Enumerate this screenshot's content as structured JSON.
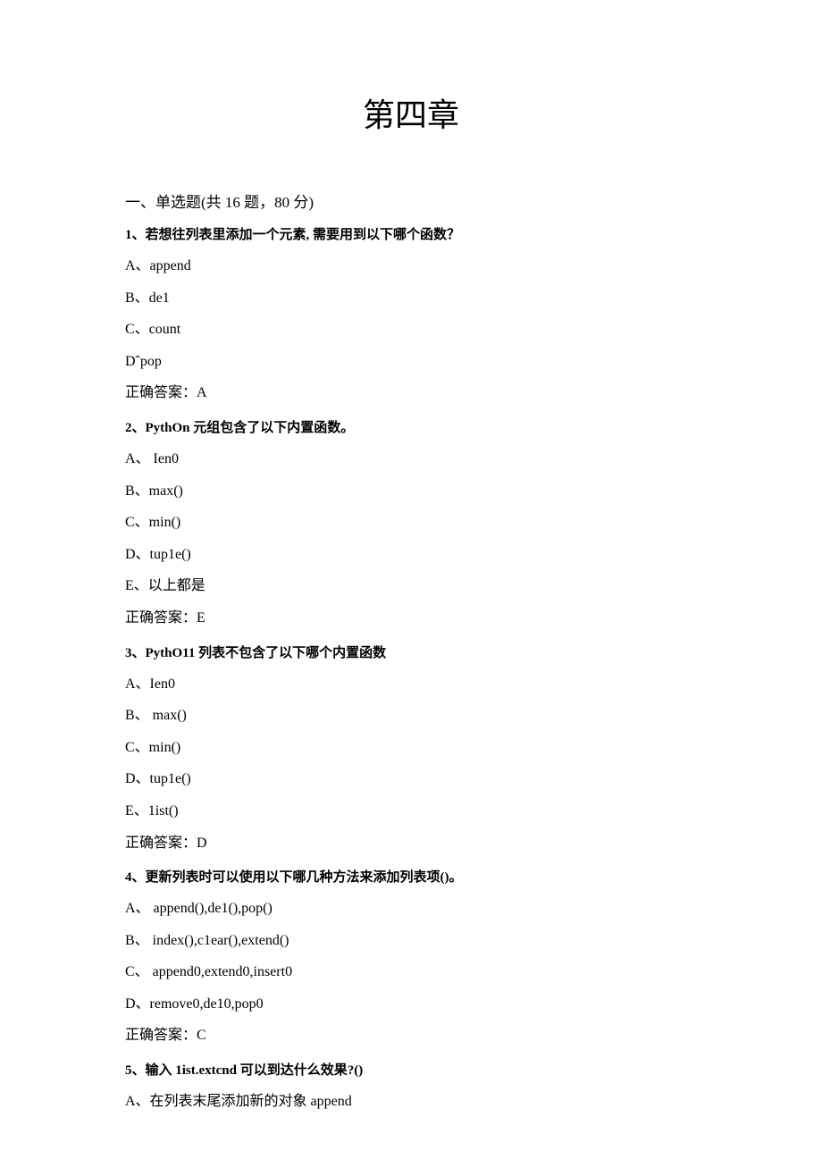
{
  "title": "第四章",
  "section_header": "一、单选题(共 16 题，80 分)",
  "questions": [
    {
      "stem": "1、若想往列表里添加一个元素, 需要用到以下哪个函数？",
      "options": [
        "A、append",
        "B、de1",
        "C、count",
        "Dˆpop"
      ],
      "answer": "正确答案：A"
    },
    {
      "stem": "2、PythOn 元组包含了以下内置函数。",
      "options": [
        "A、 Ien0",
        "B、max()",
        "C、min()",
        "D、tup1e()",
        "E、以上都是"
      ],
      "answer": "正确答案：E"
    },
    {
      "stem": "3、PythO11 列表不包含了以下哪个内置函数",
      "options": [
        "A、Ien0",
        "B、 max()",
        "C、min()",
        "D、tup1e()",
        "E、1ist()"
      ],
      "answer": "正确答案：D"
    },
    {
      "stem": "4、更新列表时可以使用以下哪几种方法来添加列表项()。",
      "options": [
        "A、 append(),de1(),pop()",
        "B、 index(),c1ear(),extend()",
        "C、 append0,extend0,insert0",
        "D、remove0,de10,pop0"
      ],
      "answer": "正确答案：C"
    },
    {
      "stem": "5、输入 1ist.extcnd 可以到达什么效果?()",
      "options": [
        "A、在列表末尾添加新的对象 append"
      ],
      "answer": ""
    }
  ]
}
